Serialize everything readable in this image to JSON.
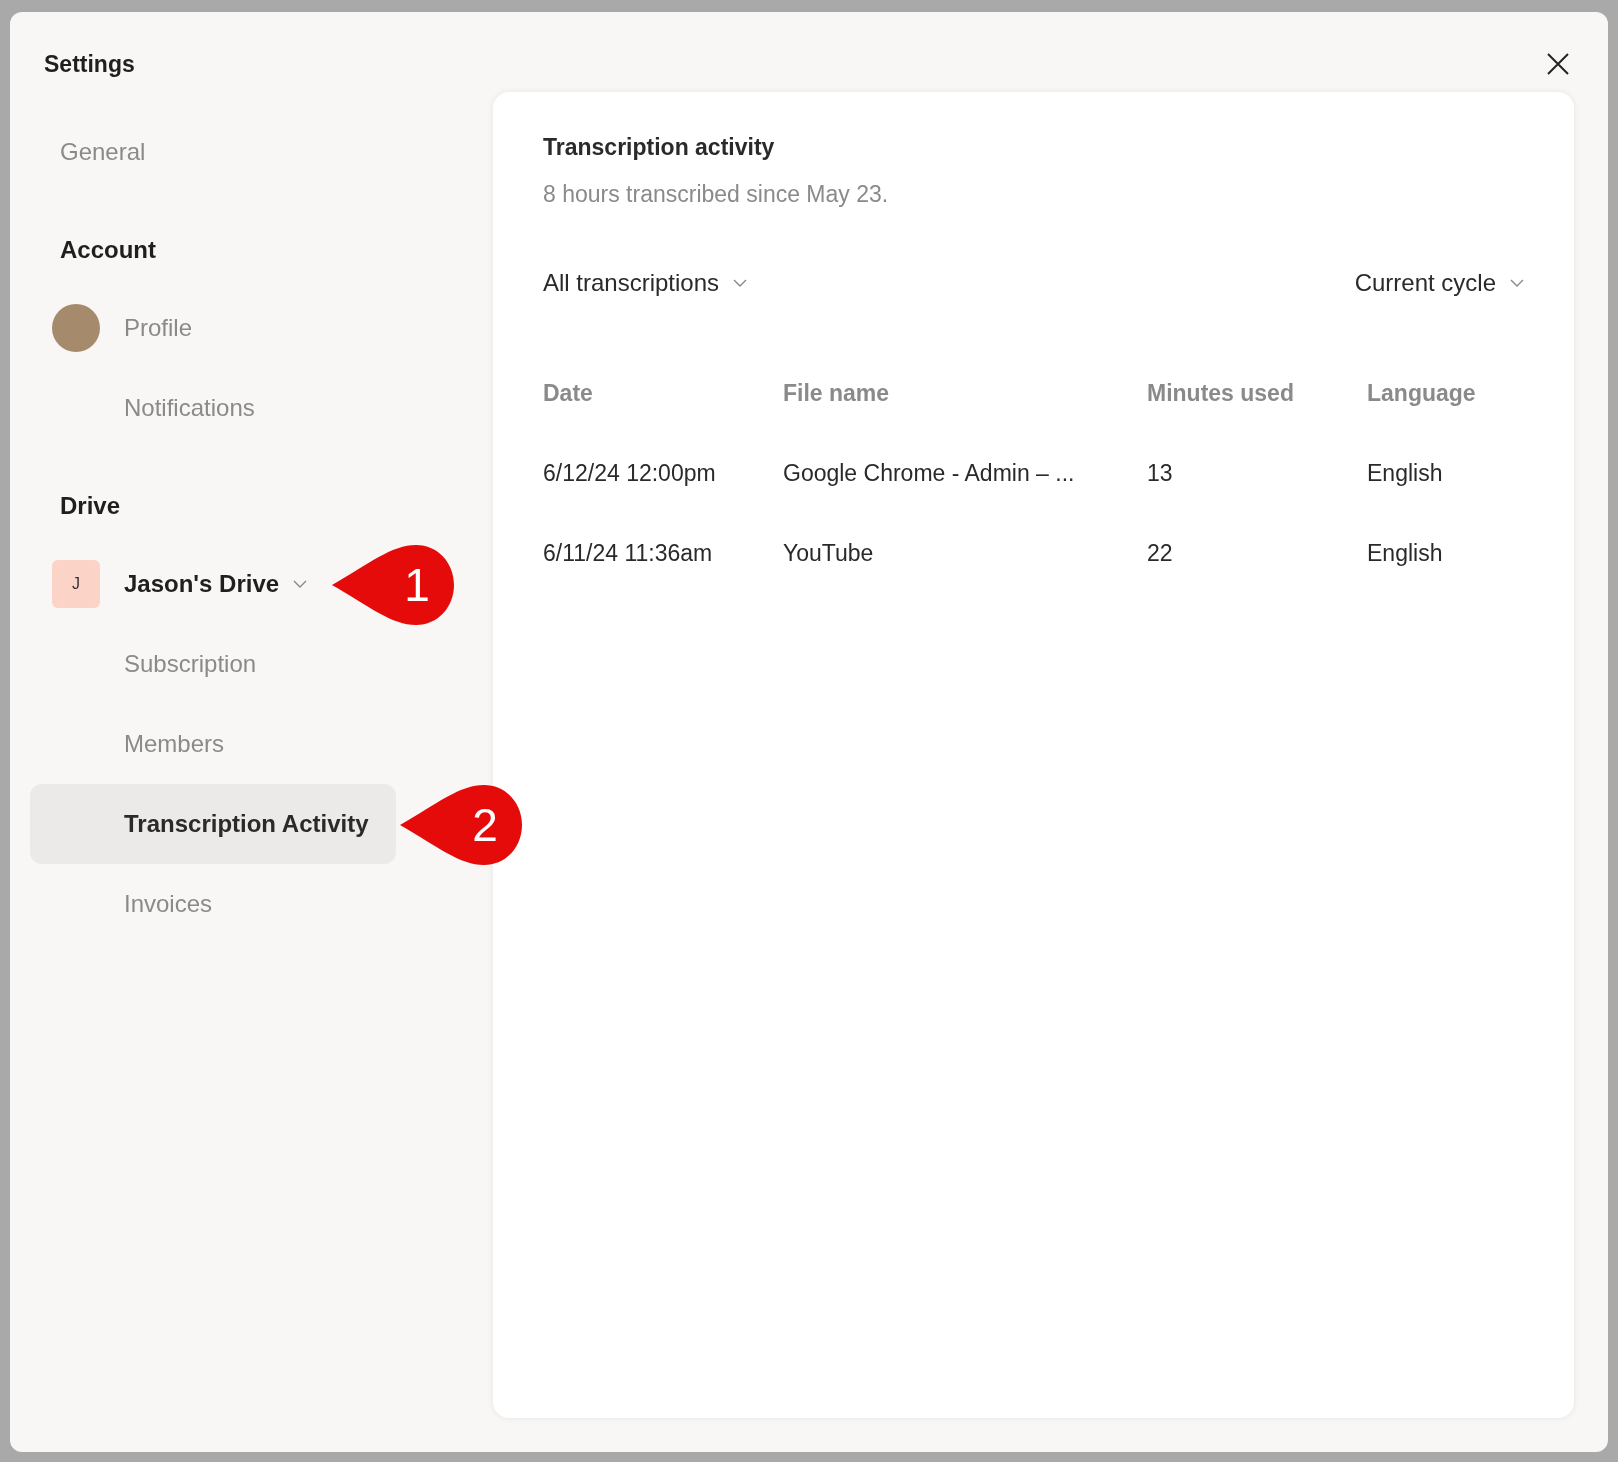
{
  "window": {
    "title": "Settings"
  },
  "sidebar": {
    "sections": [
      {
        "items": [
          {
            "label": "General",
            "kind": "plain",
            "selected": false
          }
        ]
      },
      {
        "title": "Account",
        "items": [
          {
            "label": "Profile",
            "kind": "avatar",
            "selected": false
          },
          {
            "label": "Notifications",
            "kind": "indented",
            "selected": false
          }
        ]
      },
      {
        "title": "Drive",
        "items": [
          {
            "label": "Jason's Drive",
            "kind": "drive",
            "initial": "J",
            "selected": false
          },
          {
            "label": "Subscription",
            "kind": "indented",
            "selected": false
          },
          {
            "label": "Members",
            "kind": "indented",
            "selected": false
          },
          {
            "label": "Transcription Activity",
            "kind": "indented",
            "selected": true
          },
          {
            "label": "Invoices",
            "kind": "indented",
            "selected": false
          }
        ]
      }
    ]
  },
  "content": {
    "title": "Transcription activity",
    "subtitle": "8 hours transcribed since May 23.",
    "filters": [
      {
        "label": "All transcriptions"
      },
      {
        "label": "Current cycle"
      }
    ],
    "table": {
      "columns": [
        "Date",
        "File name",
        "Minutes used",
        "Language"
      ],
      "rows": [
        [
          "6/12/24 12:00pm",
          "Google Chrome - Admin – ...",
          "13",
          "English"
        ],
        [
          "6/11/24 11:36am",
          "YouTube",
          "22",
          "English"
        ]
      ]
    }
  },
  "callouts": [
    {
      "number": "1"
    },
    {
      "number": "2"
    }
  ]
}
